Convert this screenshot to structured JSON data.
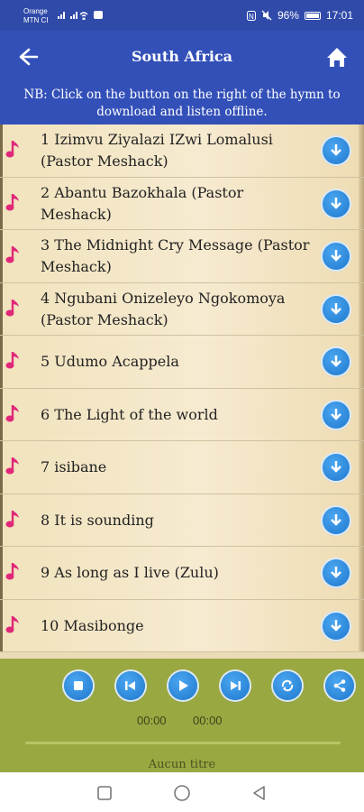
{
  "status": {
    "carrier_line1": "Orange",
    "carrier_line2": "MTN CI",
    "battery": "96%",
    "time": "17:01"
  },
  "header": {
    "title": "South Africa"
  },
  "notice": "NB: Click on the button on the right of the hymn to download and listen offline.",
  "hymns": [
    {
      "title": "1 Izimvu Ziyalazi IZwi Lomalusi (Pastor Meshack)"
    },
    {
      "title": "2 Abantu Bazokhala (Pastor Meshack)"
    },
    {
      "title": "3 The Midnight Cry Message (Pastor Meshack)"
    },
    {
      "title": "4 Ngubani Onizeleyo Ngokomoya (Pastor Meshack)"
    },
    {
      "title": "5 Udumo Acappela"
    },
    {
      "title": "6 The Light of the world"
    },
    {
      "title": "7 isibane"
    },
    {
      "title": "8 It is sounding"
    },
    {
      "title": "9 As long as I live (Zulu)"
    },
    {
      "title": "10 Masibonge"
    }
  ],
  "player": {
    "current_time": "00:00",
    "total_time": "00:00",
    "track_title": "Aucun titre",
    "progress": 0
  },
  "colors": {
    "app_bar": "#3350b8",
    "status_bar": "#2f4aa8",
    "player_bg": "#9aa842",
    "accent_note": "#e0287a",
    "button_blue": "#1f78cf"
  }
}
